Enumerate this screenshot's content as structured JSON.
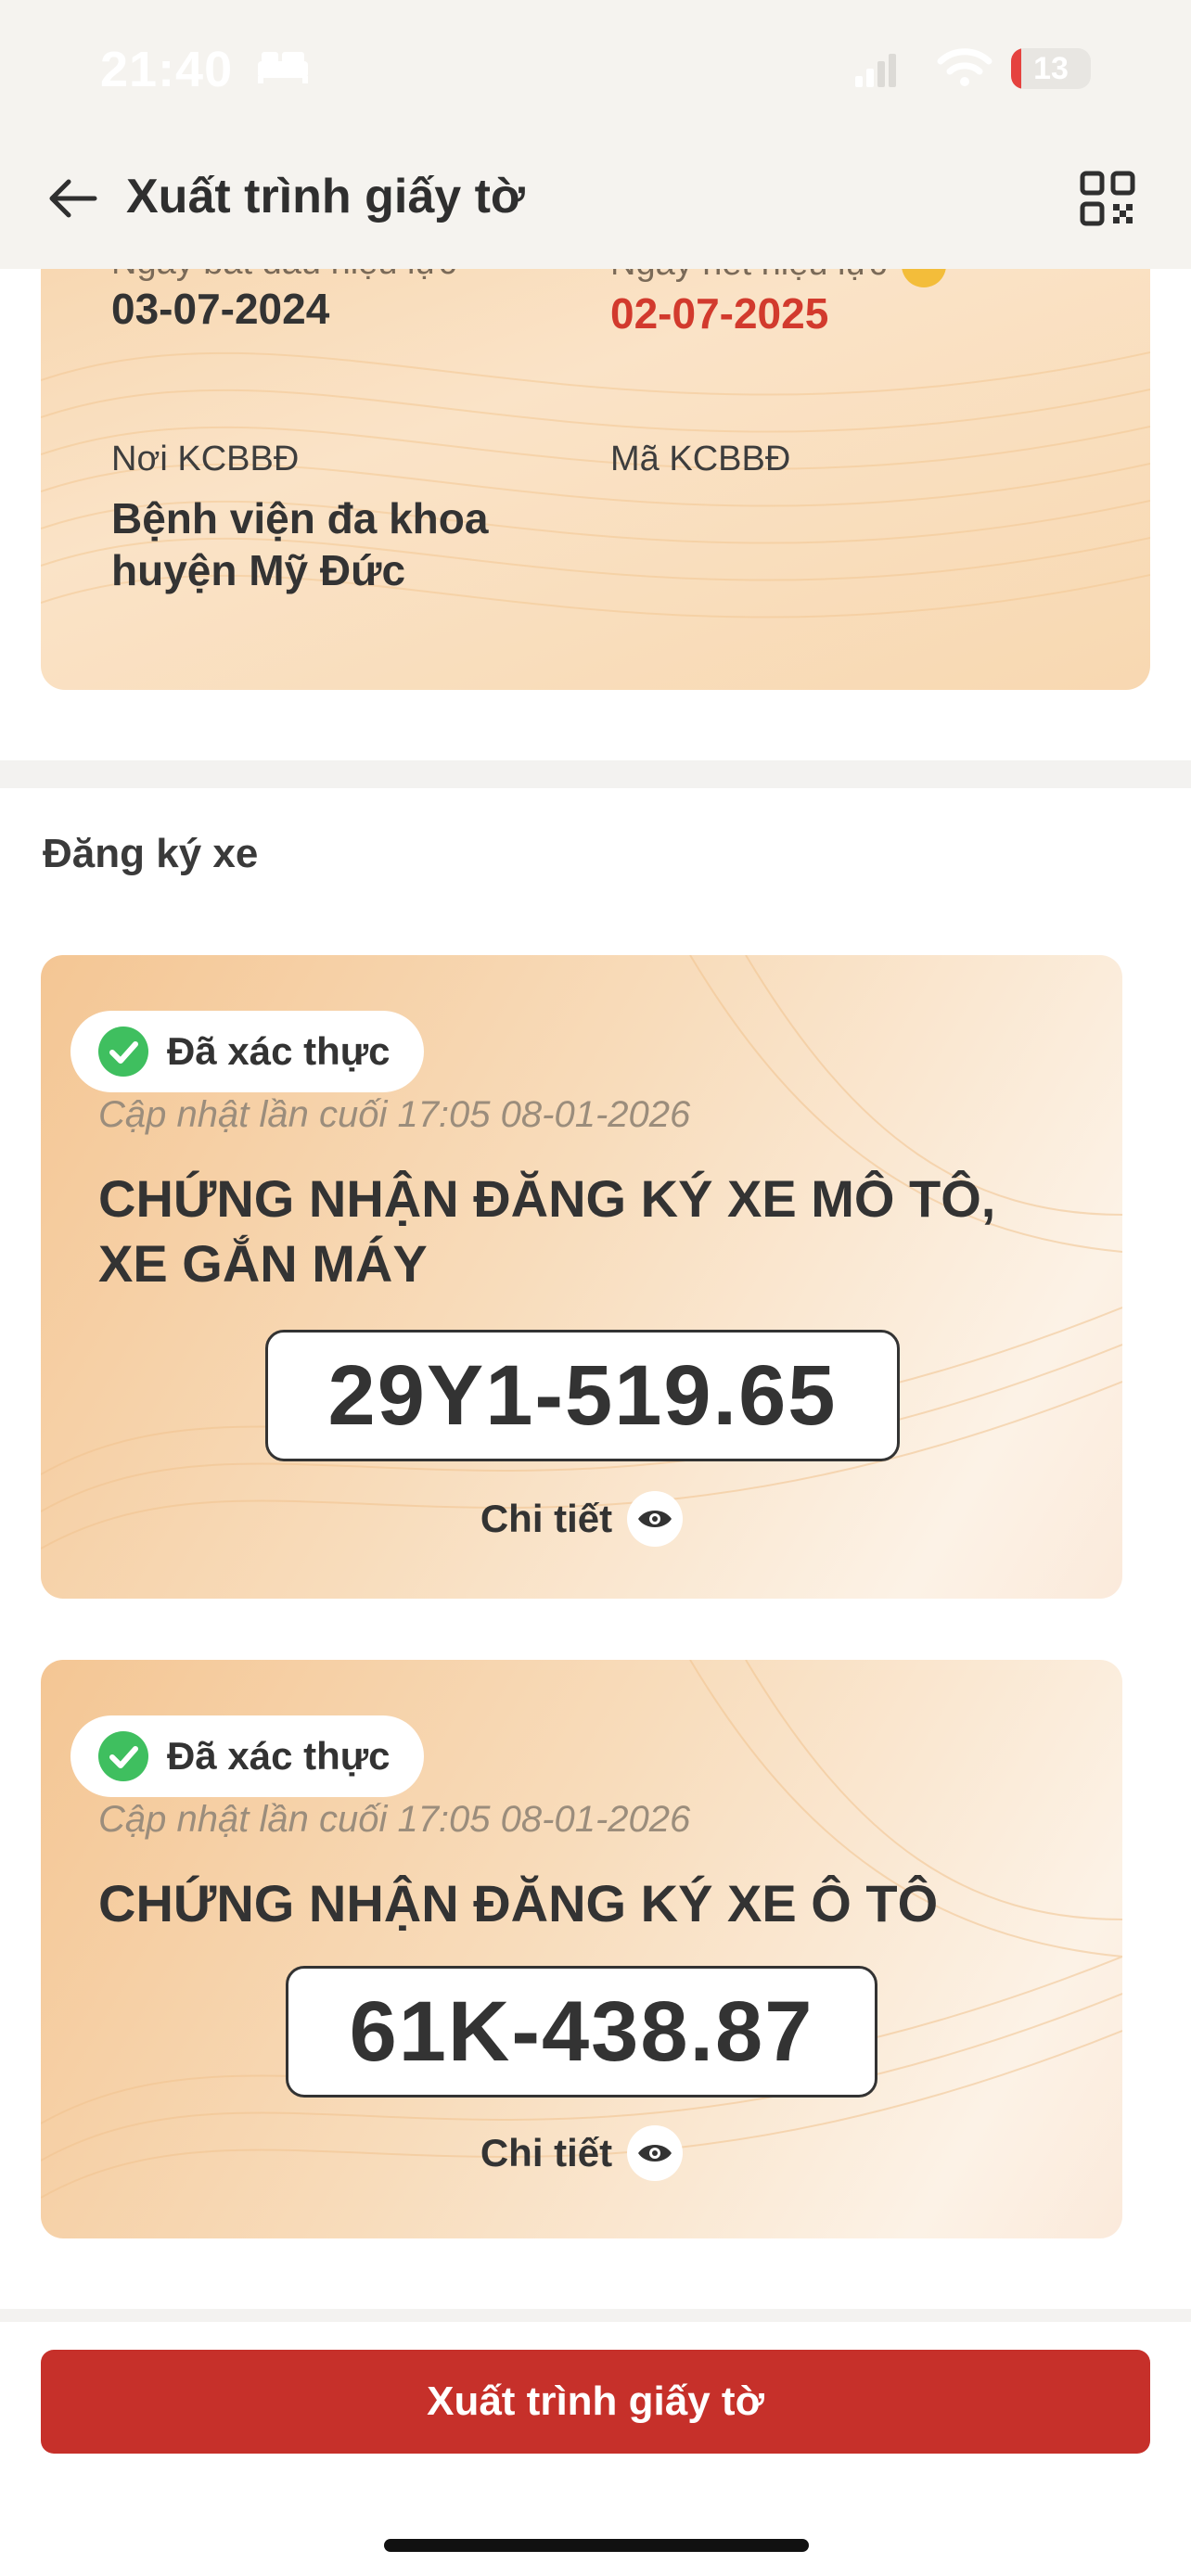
{
  "status_bar": {
    "time": "21:40",
    "battery": "13",
    "battery_percent": 13
  },
  "header": {
    "title": "Xuất trình giấy tờ"
  },
  "insurance_card": {
    "start_label": "Ngày bắt đầu hiệu lực",
    "start_value": "03-07-2024",
    "end_label": "Ngày hết hiệu lực",
    "end_value": "02-07-2025",
    "facility_label": "Nơi KCBBĐ",
    "facility_value_line1": "Bệnh viện đa khoa",
    "facility_value_line2": "huyện Mỹ Đức",
    "facility_code_label": "Mã KCBBĐ"
  },
  "section": {
    "title": "Đăng ký xe"
  },
  "vehicles": [
    {
      "status": "Đã xác thực",
      "updated": "Cập nhật lần cuối 17:05 08-01-2026",
      "title_line1": "CHỨNG NHẬN ĐĂNG KÝ XE MÔ TÔ,",
      "title_line2": "XE GẮN MÁY",
      "plate": "29Y1-519.65",
      "detail": "Chi tiết"
    },
    {
      "status": "Đã xác thực",
      "updated": "Cập nhật lần cuối 17:05 08-01-2026",
      "title_line1": "CHỨNG NHẬN ĐĂNG KÝ XE Ô TÔ",
      "plate": "61K-438.87",
      "detail": "Chi tiết"
    }
  ],
  "cta": {
    "label": "Xuất trình giấy tờ"
  },
  "colors": {
    "accent": "#c6302a",
    "verified": "#3fbf5f",
    "expired": "#d23a2d"
  },
  "icons": [
    "back-arrow-icon",
    "qr-code-icon",
    "check-circle-icon",
    "eye-icon",
    "bed-icon",
    "wifi-icon",
    "signal-icon"
  ]
}
